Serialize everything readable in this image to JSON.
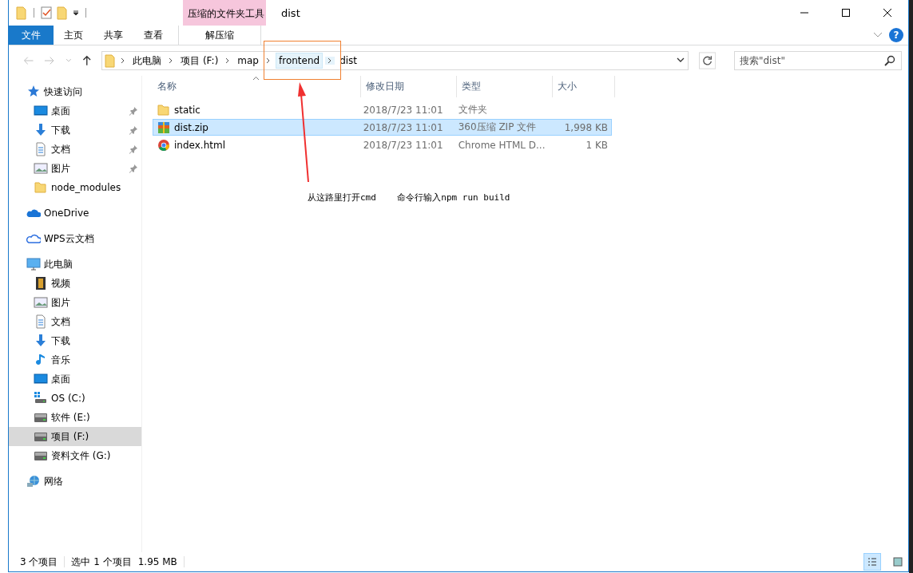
{
  "window": {
    "title": "dist",
    "context_tab_group": "压缩的文件夹工具",
    "help_button": "?"
  },
  "ribbon_tabs": [
    {
      "label": "文件",
      "kind": "file"
    },
    {
      "label": "主页",
      "kind": "normal"
    },
    {
      "label": "共享",
      "kind": "normal"
    },
    {
      "label": "查看",
      "kind": "normal"
    },
    {
      "label": "解压缩",
      "kind": "contextual"
    }
  ],
  "address_bar": {
    "breadcrumbs": [
      {
        "label": "此电脑",
        "highlighted": false
      },
      {
        "label": "项目 (F:)",
        "highlighted": false
      },
      {
        "label": "map",
        "highlighted": false
      },
      {
        "label": "frontend",
        "highlighted": true
      },
      {
        "label": "dist",
        "highlighted": false
      }
    ]
  },
  "search": {
    "placeholder": "搜索\"dist\""
  },
  "sidebar": {
    "items": [
      {
        "label": "快速访问",
        "kind": "star",
        "selected": false,
        "children": [
          {
            "label": "桌面",
            "kind": "desktop",
            "pinned": true,
            "selected": false
          },
          {
            "label": "下载",
            "kind": "download",
            "pinned": true,
            "selected": false
          },
          {
            "label": "文档",
            "kind": "document",
            "pinned": true,
            "selected": false
          },
          {
            "label": "图片",
            "kind": "picture",
            "pinned": true,
            "selected": false
          },
          {
            "label": "node_modules",
            "kind": "folder",
            "pinned": false,
            "selected": false
          }
        ]
      },
      {
        "label": "OneDrive",
        "kind": "onedrive",
        "selected": false
      },
      {
        "label": "WPS云文档",
        "kind": "cloud",
        "selected": false
      },
      {
        "label": "此电脑",
        "kind": "pc",
        "selected": false,
        "children": [
          {
            "label": "视频",
            "kind": "video",
            "selected": false
          },
          {
            "label": "图片",
            "kind": "picture",
            "selected": false
          },
          {
            "label": "文档",
            "kind": "document",
            "selected": false
          },
          {
            "label": "下载",
            "kind": "download",
            "selected": false
          },
          {
            "label": "音乐",
            "kind": "music",
            "selected": false
          },
          {
            "label": "桌面",
            "kind": "desktop",
            "selected": false
          },
          {
            "label": "OS (C:)",
            "kind": "os-drive",
            "selected": false
          },
          {
            "label": "软件 (E:)",
            "kind": "drive",
            "selected": false
          },
          {
            "label": "项目 (F:)",
            "kind": "drive",
            "selected": true
          },
          {
            "label": "资料文件 (G:)",
            "kind": "drive",
            "selected": false
          }
        ]
      },
      {
        "label": "网络",
        "kind": "network",
        "selected": false
      }
    ]
  },
  "file_list": {
    "columns": [
      {
        "label": "名称",
        "sorted": true
      },
      {
        "label": "修改日期",
        "sorted": false
      },
      {
        "label": "类型",
        "sorted": false
      },
      {
        "label": "大小",
        "sorted": false
      }
    ],
    "rows": [
      {
        "name": "static",
        "kind": "folder",
        "modified": "2018/7/23 11:01",
        "type": "文件夹",
        "selected": false
      },
      {
        "name": "dist.zip",
        "kind": "zip",
        "modified": "2018/7/23 11:01",
        "type": "360压缩 ZIP 文件",
        "size": "1,998 KB",
        "selected": true
      },
      {
        "name": "index.html",
        "kind": "chrome",
        "modified": "2018/7/23 11:01",
        "type": "Chrome HTML D...",
        "size": "1 KB",
        "selected": false
      }
    ]
  },
  "annotation": {
    "text": "从这路里打开cmd    命令行输入npm run build"
  },
  "status_bar": {
    "item_count": "3 个项目",
    "selection": "选中 1 个项目",
    "selection_size": "1.95 MB",
    "views": [
      {
        "kind": "details",
        "selected": true
      },
      {
        "kind": "thumbnails",
        "selected": false
      }
    ]
  }
}
